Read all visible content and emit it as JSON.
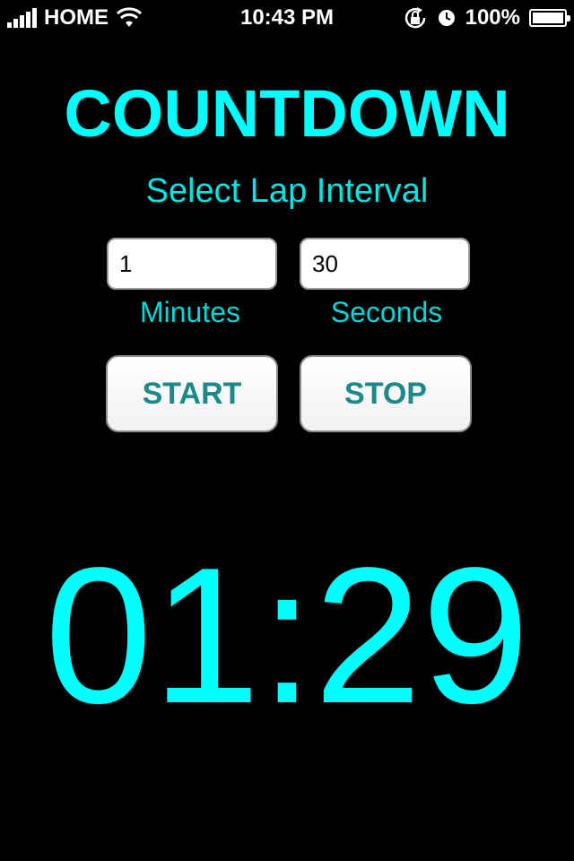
{
  "status_bar": {
    "carrier": "HOME",
    "time": "10:43 PM",
    "battery": "100%",
    "battery_level": 1.0,
    "icons": [
      "signal-icon",
      "wifi-icon",
      "rotation-lock-icon",
      "alarm-icon",
      "battery-icon"
    ]
  },
  "app": {
    "title": "COUNTDOWN",
    "subtitle": "Select Lap Interval",
    "minutes_value": "1",
    "seconds_value": "30",
    "minutes_label": "Minutes",
    "seconds_label": "Seconds",
    "start_label": "START",
    "stop_label": "STOP",
    "timer": "01:29"
  },
  "colors": {
    "accent": "#00ffff",
    "button_text": "#1c8a8a",
    "background": "#000000"
  }
}
